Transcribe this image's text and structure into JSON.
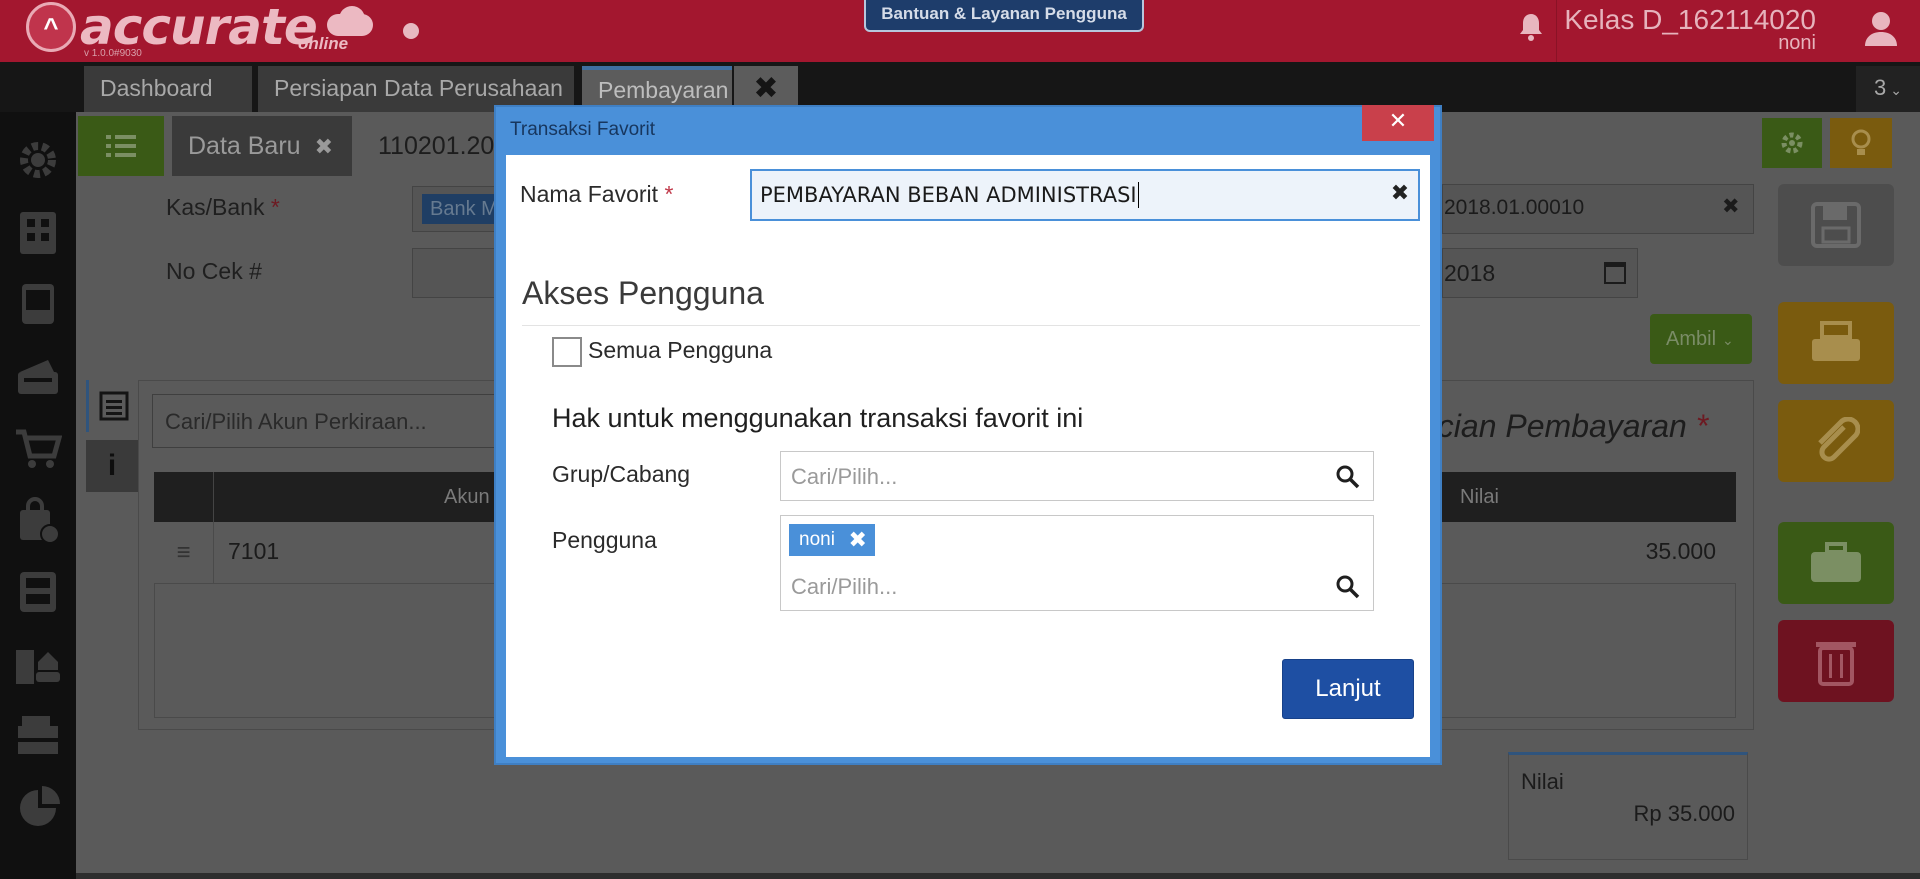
{
  "header": {
    "logo_mark": "^",
    "logo_text": "accurate",
    "logo_sub": "online",
    "version": "v 1.0.0#9030",
    "help_button": "Bantuan & Layanan Pengguna",
    "company": "Kelas D_162114020",
    "user": "noni",
    "icons": [
      "bell-icon",
      "user-avatar-icon"
    ]
  },
  "tabs": [
    {
      "label": "Dashboard"
    },
    {
      "label": "Persiapan Data Perusahaan"
    },
    {
      "label": "Pembayaran"
    }
  ],
  "tab_close": "✖",
  "tab_count": "3",
  "sidebar": {
    "icons": [
      "gear-icon",
      "building-icon",
      "book-icon",
      "wallet-icon",
      "cart-icon",
      "bag-add-icon",
      "archive-icon",
      "buildings-car-icon",
      "tax-icon",
      "pie-chart-icon"
    ]
  },
  "form": {
    "subtab_new": "Data Baru",
    "subtab_close": "✖",
    "doc_number": "110201.20",
    "kas_bank_label": "Kas/Bank",
    "req_mark": "*",
    "kas_bank_value": "Bank M",
    "no_cek_label": "No Cek #",
    "voucher_no": "2018.01.00010",
    "voucher_clear": "✖",
    "date_value": "2018",
    "ambil_label": "Ambil",
    "search_akun_placeholder": "Cari/Pilih Akun Perkiraan...",
    "rincian_title": "ncian Pembayaran",
    "table": {
      "columns": [
        "Akun",
        "Nilai"
      ],
      "rows": [
        {
          "akun": "7101",
          "nilai": "35.000"
        }
      ]
    },
    "total_label": "Nilai",
    "total_value": "Rp 35.000",
    "info_mark": "i"
  },
  "modal": {
    "title": "Transaksi Favorit",
    "close": "✕",
    "nama_favorit_label": "Nama Favorit",
    "required_mark": "*",
    "nama_favorit_value": "PEMBAYARAN BEBAN ADMINISTRASI",
    "clear": "✖",
    "akses_title": "Akses Pengguna",
    "semua_pengguna_label": "Semua Pengguna",
    "semua_pengguna_checked": false,
    "hak_title": "Hak untuk menggunakan transaksi favorit ini",
    "grup_label": "Grup/Cabang",
    "grup_placeholder": "Cari/Pilih...",
    "pengguna_label": "Pengguna",
    "pengguna_tag": "noni",
    "tag_remove": "✖",
    "pengguna_placeholder": "Cari/Pilih...",
    "lanjut_label": "Lanjut"
  },
  "colors": {
    "header_bg": "#a3172f",
    "modal_accent": "#4a90d9",
    "primary_button": "#1e4fa3",
    "close_red": "#c9404b"
  }
}
